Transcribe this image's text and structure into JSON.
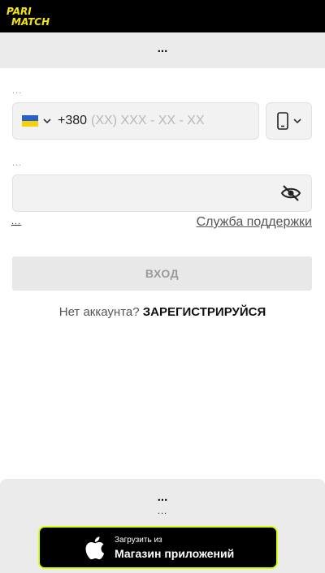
{
  "header": {
    "logo_text": "PARIMATCH",
    "brand_color": "#f5e50a"
  },
  "tabs": {
    "label": "..."
  },
  "phone": {
    "label": "...",
    "country_flag": "flag-ukraine-icon",
    "dial_code": "+380",
    "placeholder": "(XX) XXX - XX - XX",
    "device_icon": "mobile-phone-icon"
  },
  "password": {
    "label": "...",
    "value": "",
    "toggle_icon": "eye-slash-icon"
  },
  "links": {
    "forgot": "...",
    "support": "Служба поддержки"
  },
  "login_button": {
    "label": "ВХОД"
  },
  "register": {
    "question": "Нет аккаунта?",
    "link": "ЗАРЕГИСТРИРУЙСЯ"
  },
  "footer": {
    "title": "...",
    "subtitle": "...",
    "store": {
      "small": "Загрузить из",
      "big": "Магазин приложений",
      "icon": "apple-icon"
    }
  }
}
